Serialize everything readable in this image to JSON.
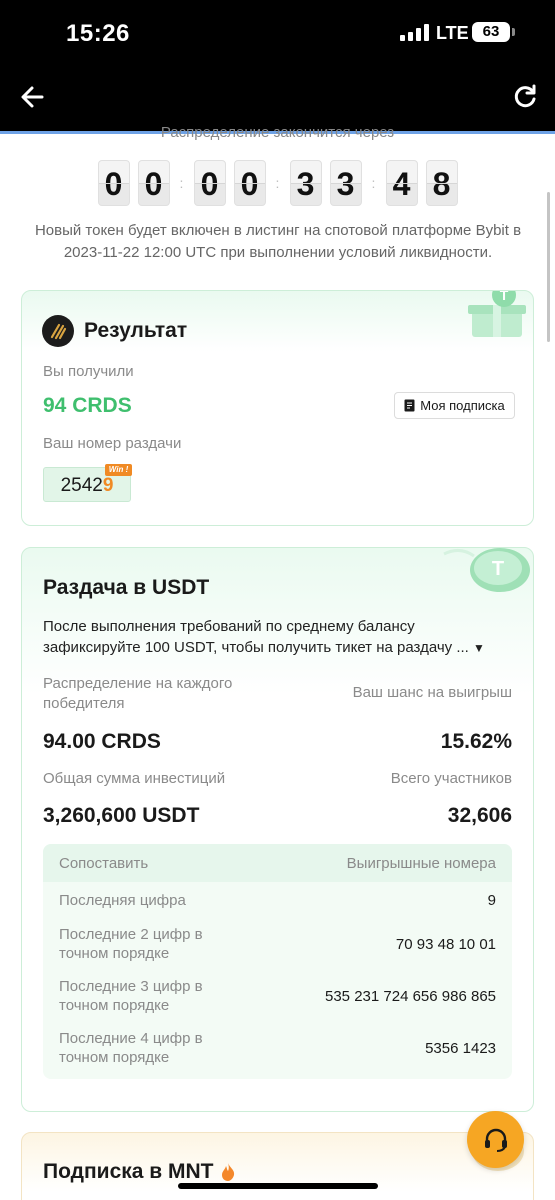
{
  "status_bar": {
    "time": "15:26",
    "network": "LTE",
    "battery": "63"
  },
  "countdown": {
    "caption_partial": "Распределение закончится через",
    "digits": [
      "0",
      "0",
      "0",
      "0",
      "3",
      "3",
      "4",
      "8"
    ]
  },
  "listing_note": "Новый токен будет включен в листинг на спотовой платформе Bybit в 2023-11-22 12:00 UTC при выполнении условий ликвидности.",
  "result": {
    "title": "Результат",
    "received_label": "Вы получили",
    "received_value": "94 CRDS",
    "subscription_button": "Моя подписка",
    "number_label": "Ваш номер раздачи",
    "ticket_prefix": "2542",
    "ticket_win_digit": "9",
    "win_badge": "Win !"
  },
  "raffle": {
    "title": "Раздача в USDT",
    "description": "После выполнения требований по среднему балансу зафиксируйте 100 USDT, чтобы получить тикет на раздачу ...",
    "per_winner_label": "Распределение на каждого победителя",
    "per_winner_value": "94.00 CRDS",
    "chance_label": "Ваш шанс на выигрыш",
    "chance_value": "15.62%",
    "total_invest_label": "Общая сумма инвестиций",
    "total_invest_value": "3,260,600 USDT",
    "participants_label": "Всего участников",
    "participants_value": "32,606",
    "table": {
      "headers": [
        "Сопоставить",
        "Выигрышные номера"
      ],
      "rows": [
        {
          "match": "Последняя цифра",
          "numbers": "9"
        },
        {
          "match": "Последние 2 цифр в точном порядке",
          "numbers": "70 93 48 10 01"
        },
        {
          "match": "Последние 3 цифр в точном порядке",
          "numbers": "535 231 724 656 986 865"
        },
        {
          "match": "Последние 4 цифр в точном порядке",
          "numbers": "5356 1423"
        }
      ]
    }
  },
  "mnt": {
    "title": "Подписка в MNT"
  },
  "colors": {
    "accent_green": "#3fbf6e",
    "win_orange": "#f08a24",
    "support_button": "#f6a623"
  }
}
